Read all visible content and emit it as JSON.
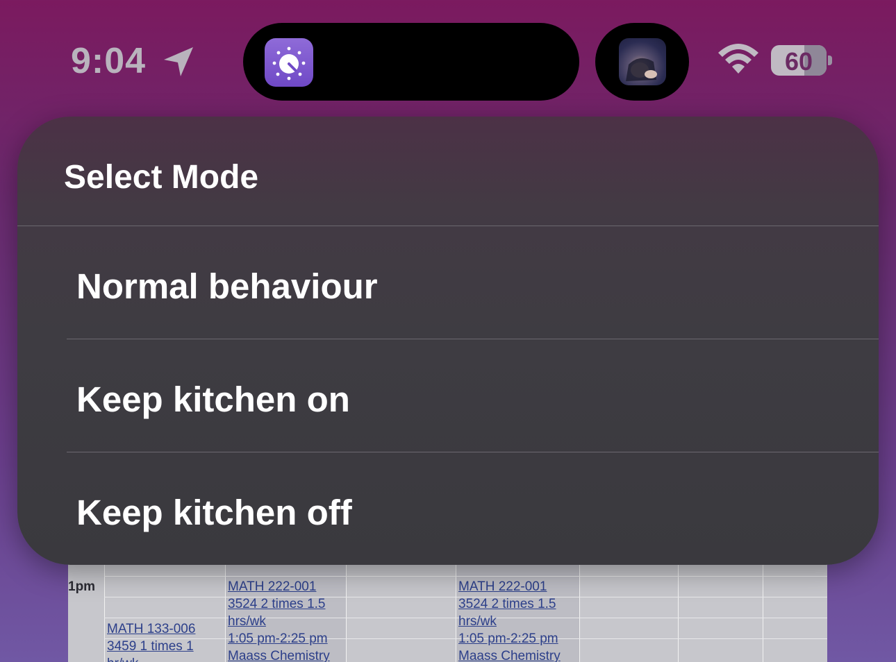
{
  "status_bar": {
    "time": "9:04",
    "battery_level": "60",
    "icons": [
      "location-arrow-icon",
      "wifi-icon",
      "battery-icon"
    ]
  },
  "dynamic_island": {
    "app_icon": "timer-dial-icon",
    "media_art": "album-art"
  },
  "menu": {
    "title": "Select Mode",
    "options": [
      {
        "label": "Normal behaviour"
      },
      {
        "label": "Keep kitchen on"
      },
      {
        "label": "Keep kitchen off"
      }
    ]
  },
  "background_schedule": {
    "time_label": "1pm",
    "entries": [
      {
        "lines": [
          "MATH 133-006",
          "3459 1 times 1",
          "hr/wk"
        ]
      },
      {
        "lines": [
          "MATH 222-001",
          "3524 2 times 1.5",
          "hrs/wk",
          "1:05 pm-2:25 pm",
          "Maass Chemistry"
        ]
      },
      {
        "lines": [
          "MATH 222-001",
          "3524 2 times 1.5",
          "hrs/wk",
          "1:05 pm-2:25 pm",
          "Maass Chemistry"
        ]
      }
    ]
  },
  "colors": {
    "sheet_background": "#3e3c42",
    "text_primary": "#ffffff",
    "divider": "#6c6970",
    "wallpaper_top": "#7b1a5f",
    "wallpaper_bottom": "#7058a4"
  }
}
